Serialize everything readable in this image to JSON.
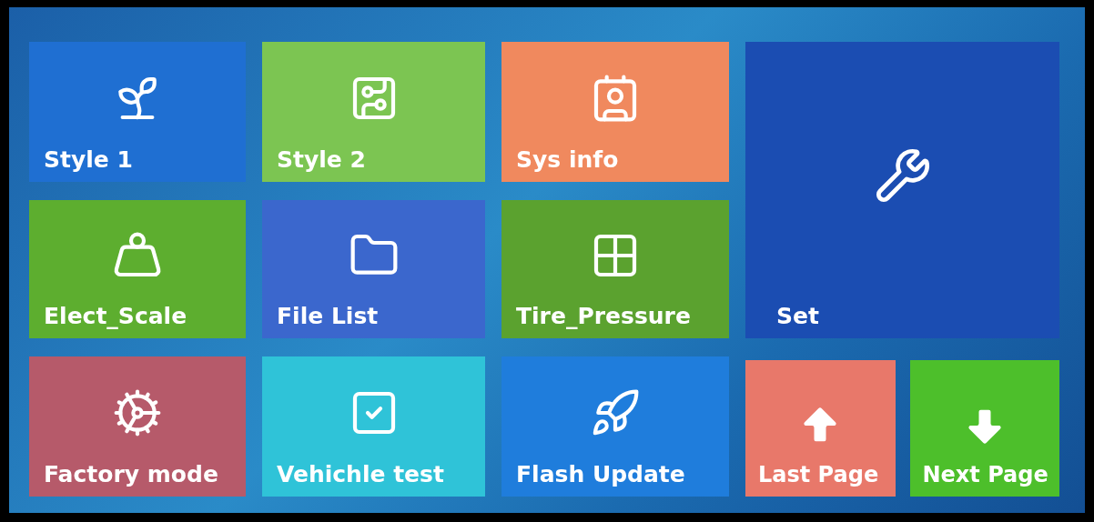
{
  "tiles": [
    {
      "label": "Style 1",
      "color": "#1f6fd2"
    },
    {
      "label": "Style 2",
      "color": "#7cc552"
    },
    {
      "label": "Sys info",
      "color": "#f0895e"
    },
    {
      "label": "Elect_Scale",
      "color": "#5dae2f"
    },
    {
      "label": "File List",
      "color": "#3b67cd"
    },
    {
      "label": "Tire_Pressure",
      "color": "#5ba22f"
    },
    {
      "label": "Factory mode",
      "color": "#b65a6a"
    },
    {
      "label": "Vehichle test",
      "color": "#2fc3d8"
    },
    {
      "label": "Flash Update",
      "color": "#1f7ddc"
    }
  ],
  "set_tile": {
    "label": "Set",
    "color": "#1b4db2"
  },
  "page_buttons": [
    {
      "label": "Last Page",
      "color": "#e8786a"
    },
    {
      "label": "Next Page",
      "color": "#4dbf2b"
    }
  ]
}
